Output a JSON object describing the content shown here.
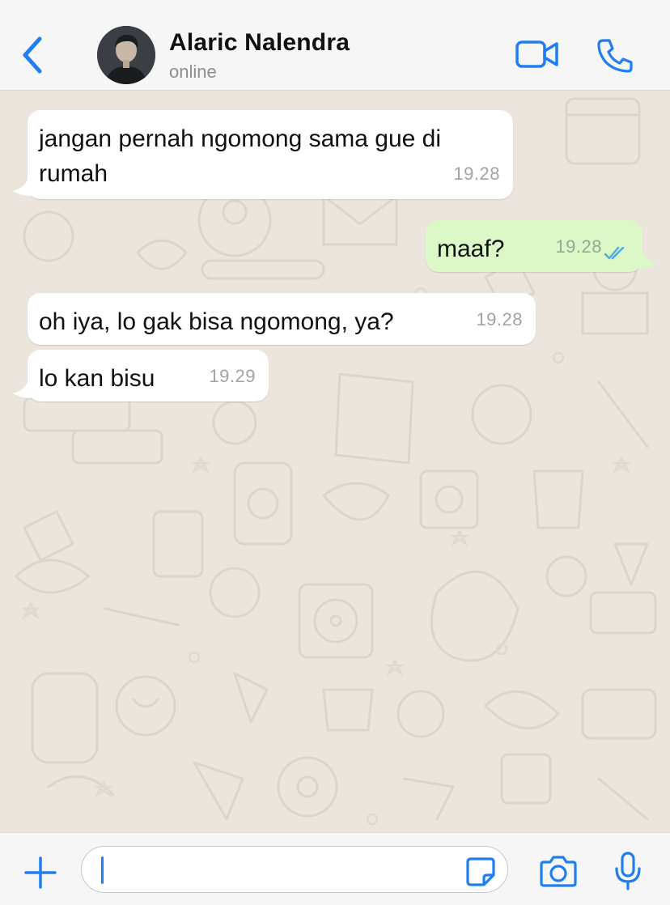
{
  "header": {
    "contact_name": "Alaric Nalendra",
    "status": "online",
    "icons": {
      "back": "chevron-left-icon",
      "video": "video-camera-icon",
      "call": "phone-icon"
    },
    "accent_color": "#1f7ef2"
  },
  "messages": [
    {
      "direction": "incoming",
      "text": "jangan pernah ngomong sama gue di rumah",
      "time": "19.28"
    },
    {
      "direction": "outgoing",
      "text": "maaf?",
      "time": "19.28",
      "status": "read"
    },
    {
      "direction": "incoming",
      "text": "oh iya, lo gak bisa ngomong, ya?",
      "time": "19.28"
    },
    {
      "direction": "incoming",
      "text": "lo kan bisu",
      "time": "19.29"
    }
  ],
  "input_bar": {
    "value": "",
    "icons": {
      "attach": "plus-icon",
      "sticker": "sticker-icon",
      "camera": "camera-icon",
      "mic": "microphone-icon"
    }
  },
  "colors": {
    "incoming_bubble": "#ffffff",
    "outgoing_bubble": "#dcf8c6",
    "chat_background": "#ece5dd",
    "read_ticks": "#4fa8e8"
  }
}
